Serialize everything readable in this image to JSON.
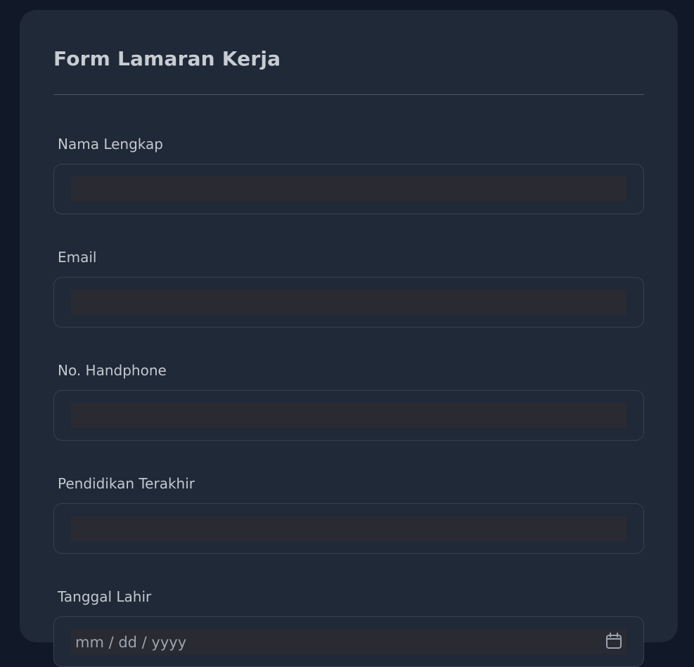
{
  "form": {
    "title": "Form Lamaran Kerja",
    "fields": [
      {
        "label": "Nama Lengkap",
        "value": ""
      },
      {
        "label": "Email",
        "value": ""
      },
      {
        "label": "No. Handphone",
        "value": ""
      },
      {
        "label": "Pendidikan Terakhir",
        "value": ""
      },
      {
        "label": "Tanggal Lahir",
        "placeholder": "mm / dd / yyyy"
      }
    ]
  },
  "icons": {
    "date_picker": "calendar-icon"
  },
  "colors": {
    "page_background": "#111827",
    "card_background": "#1f2937",
    "input_fill": "#2a2a33",
    "border": "#374151",
    "text": "#c4c8cf"
  }
}
